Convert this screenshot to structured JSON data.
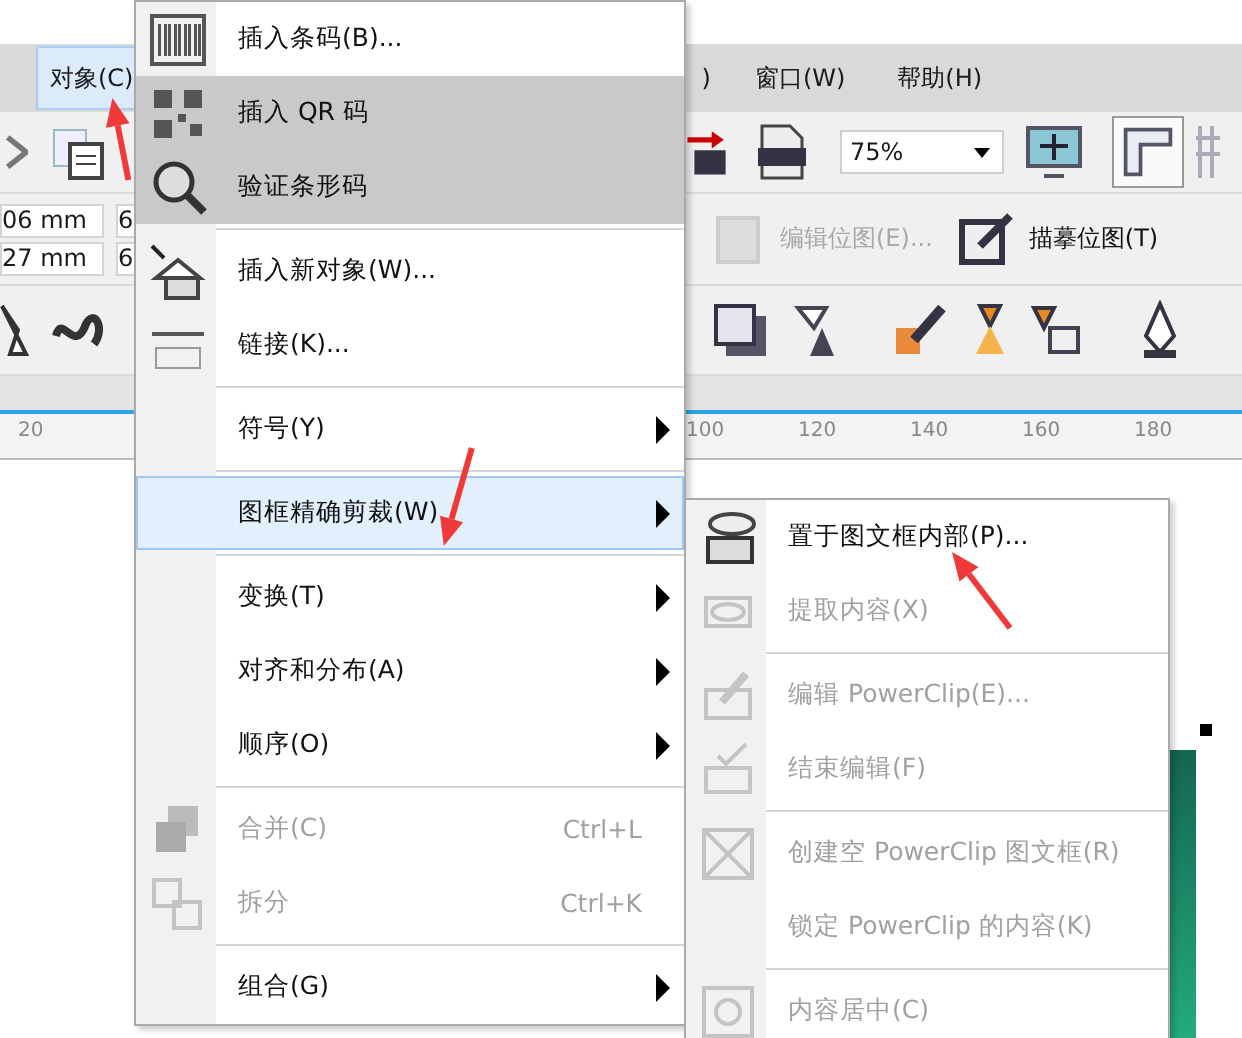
{
  "menubar": [
    {
      "label": "对象(C)",
      "selected": true
    },
    {
      "label": ")",
      "selected": false
    },
    {
      "label": "窗口(W)",
      "selected": false
    },
    {
      "label": "帮助(H)",
      "selected": false
    }
  ],
  "toolbar": {
    "zoom": "75%",
    "ruler_pressed": true
  },
  "property_bar": {
    "fields": [
      "06 mm",
      "27 mm"
    ],
    "fields_cut": [
      "6",
      "6"
    ],
    "buttons": [
      {
        "label": "编辑位图(E)...",
        "disabled": true
      },
      {
        "label": "描摹位图(T)",
        "disabled": false
      }
    ]
  },
  "ruler": {
    "ticks": [
      "20",
      "100",
      "120",
      "140",
      "160",
      "180"
    ]
  },
  "menu": [
    {
      "label": "插入条码(B)...",
      "kind": "item",
      "selected": false,
      "disabled": false,
      "submenu": false
    },
    {
      "label": "插入 QR 码",
      "kind": "item",
      "selected": false,
      "hovered": true,
      "disabled": false,
      "submenu": false
    },
    {
      "label": "验证条形码",
      "kind": "item",
      "selected": false,
      "hovered": true,
      "disabled": false,
      "submenu": false
    },
    {
      "kind": "separator"
    },
    {
      "label": "插入新对象(W)...",
      "kind": "item",
      "selected": false,
      "disabled": false,
      "submenu": false
    },
    {
      "label": "链接(K)...",
      "kind": "item",
      "selected": false,
      "disabled": false,
      "submenu": false
    },
    {
      "kind": "separator"
    },
    {
      "label": "符号(Y)",
      "kind": "item",
      "selected": false,
      "disabled": false,
      "submenu": true
    },
    {
      "kind": "separator"
    },
    {
      "label": "图框精确剪裁(W)",
      "kind": "item",
      "selected": true,
      "disabled": false,
      "submenu": true
    },
    {
      "kind": "separator"
    },
    {
      "label": "变换(T)",
      "kind": "item",
      "selected": false,
      "disabled": false,
      "submenu": true
    },
    {
      "label": "对齐和分布(A)",
      "kind": "item",
      "selected": false,
      "disabled": false,
      "submenu": true
    },
    {
      "label": "顺序(O)",
      "kind": "item",
      "selected": false,
      "disabled": false,
      "submenu": true
    },
    {
      "kind": "separator"
    },
    {
      "label": "合并(C)",
      "kind": "item",
      "selected": false,
      "disabled": true,
      "submenu": false,
      "shortcut": "Ctrl+L"
    },
    {
      "label": "拆分",
      "kind": "item",
      "selected": false,
      "disabled": true,
      "submenu": false,
      "shortcut": "Ctrl+K"
    },
    {
      "kind": "separator"
    },
    {
      "label": "组合(G)",
      "kind": "item",
      "selected": false,
      "disabled": false,
      "submenu": true
    }
  ],
  "submenu": [
    {
      "label": "置于图文框内部(P)...",
      "kind": "item",
      "disabled": false
    },
    {
      "label": "提取内容(X)",
      "kind": "item",
      "disabled": true
    },
    {
      "kind": "separator"
    },
    {
      "label": "编辑 PowerClip(E)...",
      "kind": "item",
      "disabled": true
    },
    {
      "label": "结束编辑(F)",
      "kind": "item",
      "disabled": true
    },
    {
      "kind": "separator"
    },
    {
      "label": "创建空 PowerClip 图文框(R)",
      "kind": "item",
      "disabled": true
    },
    {
      "label": "锁定 PowerClip 的内容(K)",
      "kind": "item",
      "disabled": true
    },
    {
      "kind": "separator"
    },
    {
      "label": "内容居中(C)",
      "kind": "item",
      "disabled": true
    }
  ]
}
